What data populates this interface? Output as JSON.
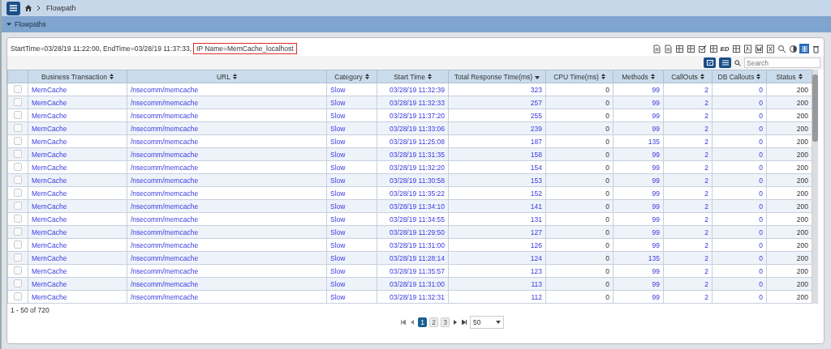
{
  "breadcrumb": {
    "current": "Flowpath"
  },
  "section": {
    "title": "Flowpaths",
    "expanded": true
  },
  "info": {
    "prefix": "StartTime=03/28/19 11:22:00, EndTime=03/28/19 11:37:33,",
    "highlight": "IP Name=MemCache_localhost"
  },
  "toolbar": [
    {
      "kind": "doc"
    },
    {
      "kind": "doc"
    },
    {
      "kind": "grid"
    },
    {
      "kind": "grid"
    },
    {
      "kind": "check"
    },
    {
      "kind": "grid"
    },
    {
      "kind": "text",
      "label": "ED"
    },
    {
      "kind": "grid"
    },
    {
      "kind": "pdf"
    },
    {
      "kind": "word"
    },
    {
      "kind": "excel"
    },
    {
      "kind": "zoom"
    },
    {
      "kind": "toggle"
    },
    {
      "kind": "active"
    },
    {
      "kind": "trash"
    }
  ],
  "search": {
    "placeholder": "Search"
  },
  "table": {
    "columns": [
      {
        "label": "Business Transaction",
        "sorted": false,
        "kind": "link"
      },
      {
        "label": "URL",
        "sorted": false,
        "kind": "link"
      },
      {
        "label": "Category",
        "sorted": false,
        "kind": "link"
      },
      {
        "label": "Start Time",
        "sorted": false,
        "kind": "link"
      },
      {
        "label": "Total Response Time(ms)",
        "sorted": true,
        "kind": "link"
      },
      {
        "label": "CPU Time(ms)",
        "sorted": false,
        "kind": "plain"
      },
      {
        "label": "Methods",
        "sorted": false,
        "kind": "link"
      },
      {
        "label": "CallOuts",
        "sorted": false,
        "kind": "link"
      },
      {
        "label": "DB Callouts",
        "sorted": false,
        "kind": "link"
      },
      {
        "label": "Status",
        "sorted": false,
        "kind": "plain"
      }
    ],
    "rows": [
      {
        "checked": false,
        "cells": [
          "MemCache",
          "/nsecomm/memcache",
          "Slow",
          "03/28/19 11:32:39",
          "323",
          "0",
          "99",
          "2",
          "0",
          "200"
        ]
      },
      {
        "checked": false,
        "cells": [
          "MemCache",
          "/nsecomm/memcache",
          "Slow",
          "03/28/19 11:32:33",
          "257",
          "0",
          "99",
          "2",
          "0",
          "200"
        ]
      },
      {
        "checked": false,
        "cells": [
          "MemCache",
          "/nsecomm/memcache",
          "Slow",
          "03/28/19 11:37:20",
          "255",
          "0",
          "99",
          "2",
          "0",
          "200"
        ]
      },
      {
        "checked": false,
        "cells": [
          "MemCache",
          "/nsecomm/memcache",
          "Slow",
          "03/28/19 11:33:06",
          "239",
          "0",
          "99",
          "2",
          "0",
          "200"
        ]
      },
      {
        "checked": false,
        "cells": [
          "MemCache",
          "/nsecomm/memcache",
          "Slow",
          "03/28/19 11:25:08",
          "187",
          "0",
          "135",
          "2",
          "0",
          "200"
        ]
      },
      {
        "checked": false,
        "cells": [
          "MemCache",
          "/nsecomm/memcache",
          "Slow",
          "03/28/19 11:31:35",
          "158",
          "0",
          "99",
          "2",
          "0",
          "200"
        ]
      },
      {
        "checked": false,
        "cells": [
          "MemCache",
          "/nsecomm/memcache",
          "Slow",
          "03/28/19 11:32:20",
          "154",
          "0",
          "99",
          "2",
          "0",
          "200"
        ]
      },
      {
        "checked": false,
        "cells": [
          "MemCache",
          "/nsecomm/memcache",
          "Slow",
          "03/28/19 11:30:58",
          "153",
          "0",
          "99",
          "2",
          "0",
          "200"
        ]
      },
      {
        "checked": false,
        "cells": [
          "MemCache",
          "/nsecomm/memcache",
          "Slow",
          "03/28/19 11:35:22",
          "152",
          "0",
          "99",
          "2",
          "0",
          "200"
        ]
      },
      {
        "checked": false,
        "cells": [
          "MemCache",
          "/nsecomm/memcache",
          "Slow",
          "03/28/19 11:34:10",
          "141",
          "0",
          "99",
          "2",
          "0",
          "200"
        ]
      },
      {
        "checked": false,
        "cells": [
          "MemCache",
          "/nsecomm/memcache",
          "Slow",
          "03/28/19 11:34:55",
          "131",
          "0",
          "99",
          "2",
          "0",
          "200"
        ]
      },
      {
        "checked": false,
        "cells": [
          "MemCache",
          "/nsecomm/memcache",
          "Slow",
          "03/28/19 11:29:50",
          "127",
          "0",
          "99",
          "2",
          "0",
          "200"
        ]
      },
      {
        "checked": false,
        "cells": [
          "MemCache",
          "/nsecomm/memcache",
          "Slow",
          "03/28/19 11:31:00",
          "126",
          "0",
          "99",
          "2",
          "0",
          "200"
        ]
      },
      {
        "checked": false,
        "cells": [
          "MemCache",
          "/nsecomm/memcache",
          "Slow",
          "03/28/19 11:28:14",
          "124",
          "0",
          "135",
          "2",
          "0",
          "200"
        ]
      },
      {
        "checked": false,
        "cells": [
          "MemCache",
          "/nsecomm/memcache",
          "Slow",
          "03/28/19 11:35:57",
          "123",
          "0",
          "99",
          "2",
          "0",
          "200"
        ]
      },
      {
        "checked": false,
        "cells": [
          "MemCache",
          "/nsecomm/memcache",
          "Slow",
          "03/28/19 11:31:00",
          "113",
          "0",
          "99",
          "2",
          "0",
          "200"
        ]
      },
      {
        "checked": false,
        "cells": [
          "MemCache",
          "/nsecomm/memcache",
          "Slow",
          "03/28/19 11:32:31",
          "112",
          "0",
          "99",
          "2",
          "0",
          "200"
        ]
      }
    ]
  },
  "footer": {
    "count": "1 - 50 of 720"
  },
  "pager": {
    "pages": [
      {
        "label": "1",
        "selected": true
      },
      {
        "label": "2",
        "selected": false
      },
      {
        "label": "3",
        "selected": false
      }
    ],
    "page_size": "50"
  }
}
